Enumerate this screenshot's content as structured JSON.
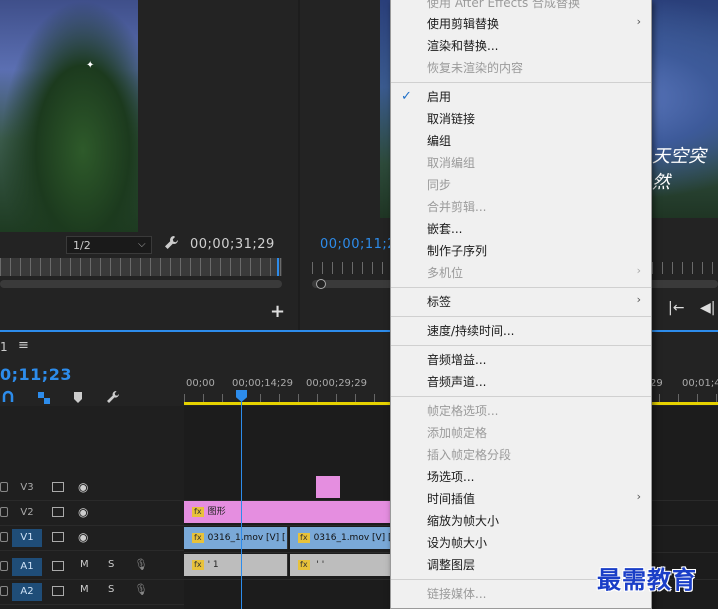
{
  "source_monitor": {
    "zoom": "1/2",
    "timecode": "00;00;31;29"
  },
  "program_monitor": {
    "timecode": "00;00;11;23",
    "caption": "天空突然"
  },
  "timeline": {
    "tab_name": "1",
    "tab_menu": "≡",
    "timecode": "0;11;23",
    "ruler": [
      "00;00",
      "00;00;14;29",
      "00;00;29;29",
      "29",
      "00;01;4"
    ],
    "tracks": [
      {
        "name": "V3",
        "type": "video"
      },
      {
        "name": "V2",
        "type": "video"
      },
      {
        "name": "V1",
        "type": "video",
        "active": true
      },
      {
        "name": "A1",
        "type": "audio",
        "active": true
      },
      {
        "name": "A2",
        "type": "audio",
        "active": true
      }
    ],
    "audio_labels": {
      "mute": "M",
      "solo": "S"
    },
    "clips": {
      "graphic": "图形",
      "video1": "0316_1.mov [V] [",
      "video2": "0316_1.mov [V] [",
      "audio1": "'       1",
      "audio2": "   '          '"
    },
    "fx_label": "fx"
  },
  "context_menu": {
    "items": [
      {
        "label": "使用 After Effects 合成替换",
        "disabled": true
      },
      {
        "label": "使用剪辑替换",
        "submenu": true
      },
      {
        "label": "渲染和替换..."
      },
      {
        "label": "恢复未渲染的内容",
        "disabled": true
      },
      {
        "label": "启用",
        "checked": true
      },
      {
        "label": "取消链接"
      },
      {
        "label": "编组"
      },
      {
        "label": "取消编组",
        "disabled": true
      },
      {
        "label": "同步",
        "disabled": true
      },
      {
        "label": "合并剪辑...",
        "disabled": true
      },
      {
        "label": "嵌套..."
      },
      {
        "label": "制作子序列"
      },
      {
        "label": "多机位",
        "disabled": true,
        "submenu": true
      },
      {
        "label": "标签",
        "submenu": true
      },
      {
        "label": "速度/持续时间..."
      },
      {
        "label": "音频增益..."
      },
      {
        "label": "音频声道..."
      },
      {
        "label": "帧定格选项...",
        "disabled": true
      },
      {
        "label": "添加帧定格",
        "disabled": true
      },
      {
        "label": "插入帧定格分段",
        "disabled": true
      },
      {
        "label": "场选项..."
      },
      {
        "label": "时间插值",
        "submenu": true
      },
      {
        "label": "缩放为帧大小"
      },
      {
        "label": "设为帧大小"
      },
      {
        "label": "调整图层"
      },
      {
        "label": "链接媒体...",
        "disabled": true
      }
    ],
    "check_glyph": "✓",
    "arrow_glyph": "›"
  },
  "watermark": "最需教育",
  "colors": {
    "accent": "#2d8ceb",
    "graphic_clip": "#e58ee0",
    "video_clip": "#7aa9d8",
    "audio_clip": "#bdbdbd",
    "workarea": "#e6d200",
    "watermark": "#1a3ec7"
  }
}
